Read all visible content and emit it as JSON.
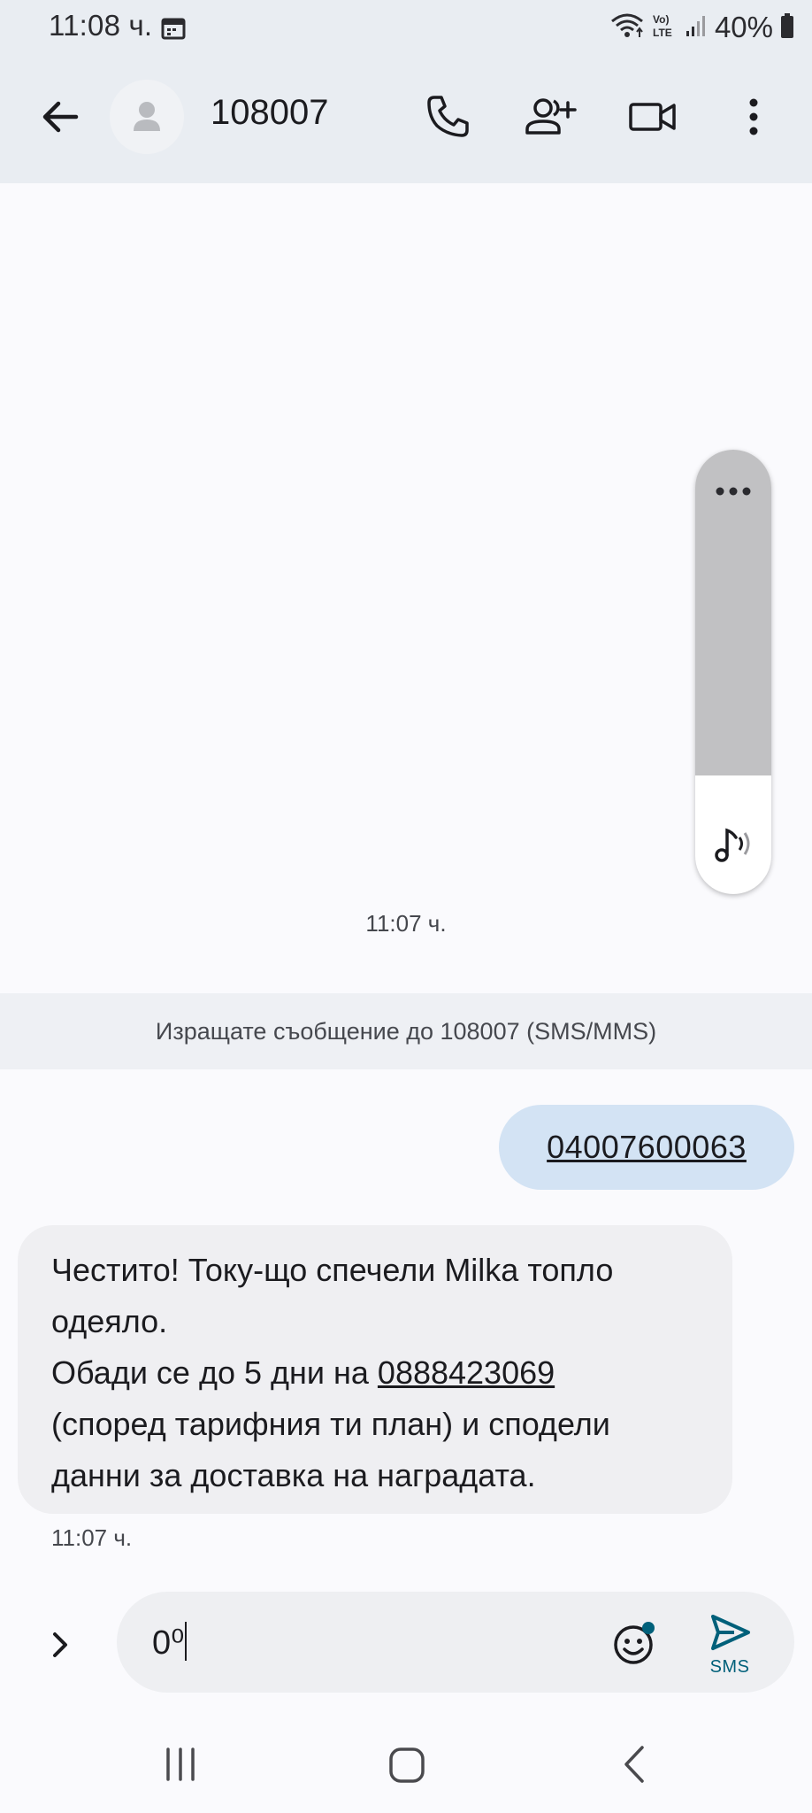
{
  "status_bar": {
    "time": "11:08 ч.",
    "battery": "40%",
    "icons": [
      "calendar-icon",
      "wifi-icon",
      "volte-icon",
      "signal-icon",
      "battery-icon"
    ]
  },
  "app_bar": {
    "contact": "108007",
    "icons": [
      "back-arrow-icon",
      "avatar-icon",
      "phone-icon",
      "add-person-icon",
      "video-icon",
      "more-vert-icon"
    ]
  },
  "conversation": {
    "timestamp_top": "11:07 ч.",
    "banner": "Изращате съобщение до 108007 (SMS/MMS)",
    "outgoing": "04007600063",
    "incoming": {
      "line1": "Честито! Току-що спечели Milka топло",
      "line2": "одеяло.",
      "line3_prefix": "Обади се до 5 дни на ",
      "phone": "0888423069",
      "line4": "(според тарифния ти план) и сподели",
      "line5": "данни за доставка на наградата.",
      "time": "11:07 ч."
    }
  },
  "compose": {
    "value": "0⁰",
    "send_label": "SMS",
    "icons": [
      "chevron-right-icon",
      "emoji-icon",
      "send-icon"
    ]
  },
  "colors": {
    "bar_bg": "#e9edf2",
    "out_bubble": "#d3e3f4",
    "in_bubble": "#efeff2",
    "accent": "#00607a"
  }
}
